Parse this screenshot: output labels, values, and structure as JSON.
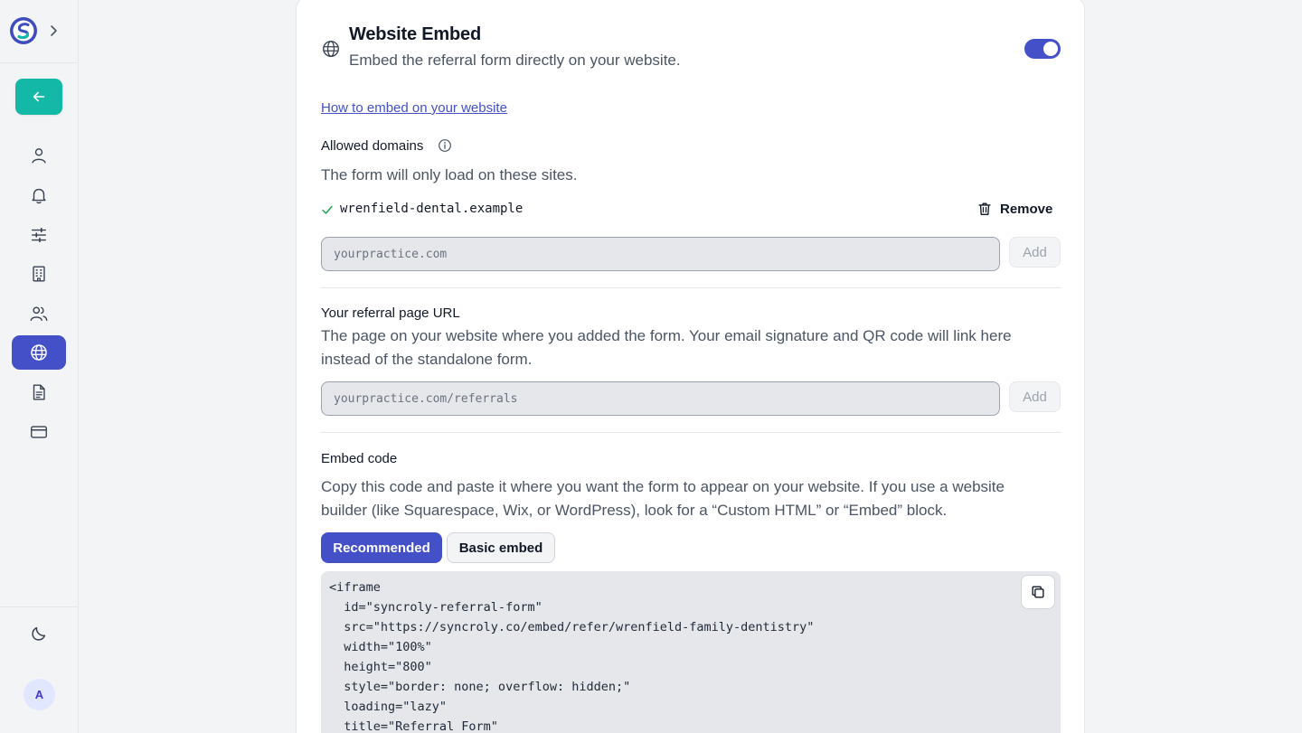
{
  "sidebar": {
    "nav": [
      {
        "name": "user-icon",
        "active": false
      },
      {
        "name": "bell-icon",
        "active": false
      },
      {
        "name": "sliders-icon",
        "active": false
      },
      {
        "name": "building-icon",
        "active": false
      },
      {
        "name": "users-icon",
        "active": false
      },
      {
        "name": "globe-icon",
        "active": true
      },
      {
        "name": "document-icon",
        "active": false
      },
      {
        "name": "credit-card-icon",
        "active": false
      }
    ],
    "theme_icon": "moon-icon",
    "avatar_initial": "A"
  },
  "embed": {
    "title": "Website Embed",
    "subtitle": "Embed the referral form directly on your website.",
    "enabled": true,
    "how_to_link": "How to embed on your website"
  },
  "allowed_domains": {
    "label": "Allowed domains",
    "description": "The form will only load on these sites.",
    "domains": [
      "wrenfield-dental.example"
    ],
    "remove_label": "Remove",
    "input_placeholder": "yourpractice.com",
    "add_label": "Add"
  },
  "referral_url": {
    "label": "Your referral page URL",
    "description_line1": "The page on your website where you added the form. Your email signature and QR code will link here",
    "description_line2": "instead of the standalone form.",
    "input_placeholder": "yourpractice.com/referrals",
    "add_label": "Add"
  },
  "embed_code": {
    "label": "Embed code",
    "description_line1": "Copy this code and paste it where you want the form to appear on your website. If you use a website",
    "description_line2": "builder (like Squarespace, Wix, or WordPress), look for a “Custom HTML” or “Embed” block.",
    "tabs": [
      "Recommended",
      "Basic embed"
    ],
    "active_tab": "Recommended",
    "code_lines": [
      "<iframe",
      "  id=\"syncroly-referral-form\"",
      "  src=\"https://syncroly.co/embed/refer/wrenfield-family-dentistry\"",
      "  width=\"100%\"",
      "  height=\"800\"",
      "  style=\"border: none; overflow: hidden;\"",
      "  loading=\"lazy\"",
      "  title=\"Referral Form\""
    ]
  },
  "colors": {
    "accent": "#4450c8",
    "teal": "#14b8a6",
    "success": "#16a34a"
  }
}
